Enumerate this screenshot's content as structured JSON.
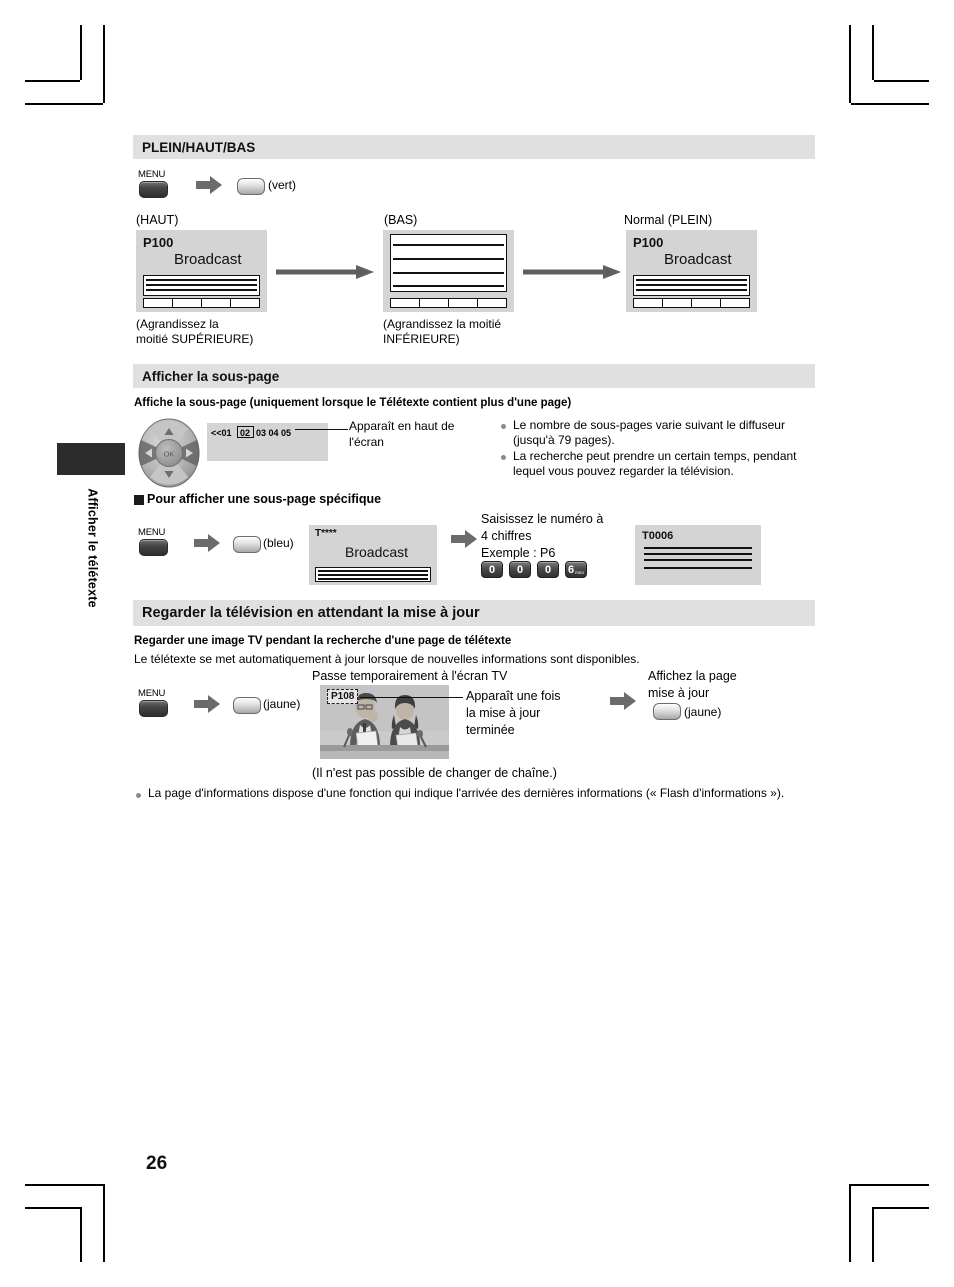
{
  "document": {
    "page_number": "26",
    "sidebar_label": "Afficher le télétexte"
  },
  "sections": [
    {
      "id": "plein-haut-bas",
      "title": "PLEIN/HAUT/BAS",
      "step": {
        "menu_label": "MENU",
        "color_button": "(vert)"
      },
      "screens": [
        {
          "caption": "(HAUT)",
          "page_id": "P100",
          "broadcast": "Broadcast",
          "note_line1": "(Agrandissez la",
          "note_line2": "moitié SUPÉRIEURE)"
        },
        {
          "caption": "(BAS)",
          "page_id": "",
          "broadcast": "",
          "note_line1": "(Agrandissez la moitié",
          "note_line2": "INFÉRIEURE)"
        },
        {
          "caption": "Normal (PLEIN)",
          "page_id": "P100",
          "broadcast": "Broadcast",
          "note_line1": "",
          "note_line2": ""
        }
      ]
    },
    {
      "id": "afficher-la-sous-page",
      "title": "Afficher la sous-page",
      "subtitle": "Affiche la sous-page (uniquement lorsque le Télétexte contient plus d'une page)",
      "indicator": {
        "prefix": "<<01",
        "selected": "02",
        "rest": "03 04 05",
        "callout_line1": "Apparaît en haut de",
        "callout_line2": "l'écran"
      },
      "notes": [
        "Le nombre de sous-pages varie suivant le diffuseur (jusqu'à 79 pages).",
        "La recherche peut prendre un certain temps, pendant lequel vous pouvez regarder la télévision."
      ],
      "subheading": "Pour afficher une sous-page spécifique",
      "step": {
        "menu_label": "MENU",
        "color_button": "(bleu)"
      },
      "screen_before": {
        "page_id": "T****",
        "broadcast": "Broadcast"
      },
      "entry": {
        "line1": "Saisissez le numéro à",
        "line2": "4 chiffres",
        "line3": "Exemple : P6",
        "keys": [
          "0",
          "0",
          "0",
          "6"
        ],
        "key4_sub": "mno"
      },
      "screen_after": {
        "page_id": "T0006"
      }
    },
    {
      "id": "regarder-television",
      "title": "Regarder la télévision en attendant la mise à jour",
      "subtitle": "Regarder une image TV pendant la recherche d'une page de télétexte",
      "intro": "Le télétexte se met automatiquement à jour lorsque de nouvelles informations sont disponibles.",
      "step": {
        "menu_label": "MENU",
        "color_button": "(jaune)"
      },
      "photo": {
        "heading": "Passe temporairement à l'écran TV",
        "page_label": "P108",
        "callout_line1": "Apparaît une fois",
        "callout_line2": "la mise à jour",
        "callout_line3": "terminée",
        "caption": "(Il n'est pas possible de changer de chaîne.)"
      },
      "final_step": {
        "line1": "Affichez la page",
        "line2": "mise à jour",
        "color_button": "(jaune)"
      },
      "footer_note": "La page d'informations dispose d'une fonction qui indique l'arrivée des dernières informations (« Flash d'informations »)."
    }
  ],
  "colors": {
    "section_bar": "#e0e0e0",
    "screen_bg": "#d4d4d4",
    "ink": "#111111"
  }
}
